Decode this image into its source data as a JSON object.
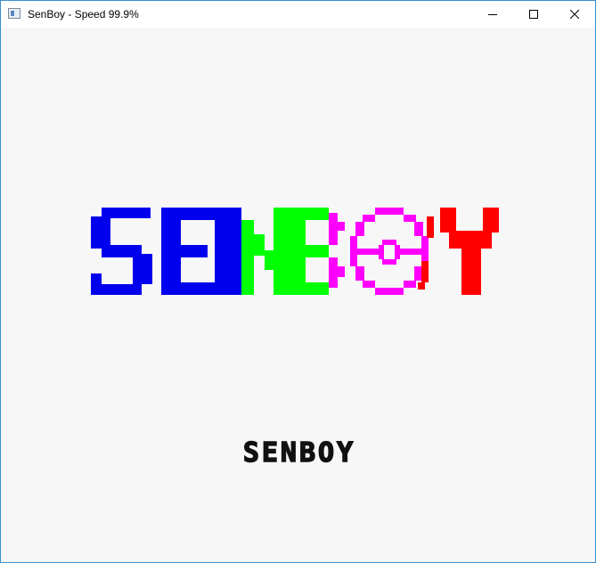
{
  "window": {
    "title": "SenBoy - Speed 99.9%",
    "icon": "app-icon"
  },
  "controls": {
    "minimize": "minimize-icon",
    "maximize": "maximize-icon",
    "close": "close-icon"
  },
  "screen": {
    "logo_text": "SENBOY",
    "logo_letter_colors": {
      "S": "#0000ee",
      "E": "#0000ee",
      "N": "#00ff00",
      "B": "#00ff00",
      "O": "#ff00ff",
      "Y": "#ff0000"
    },
    "caption": "SENBOY",
    "background": "#f7f7f7"
  }
}
